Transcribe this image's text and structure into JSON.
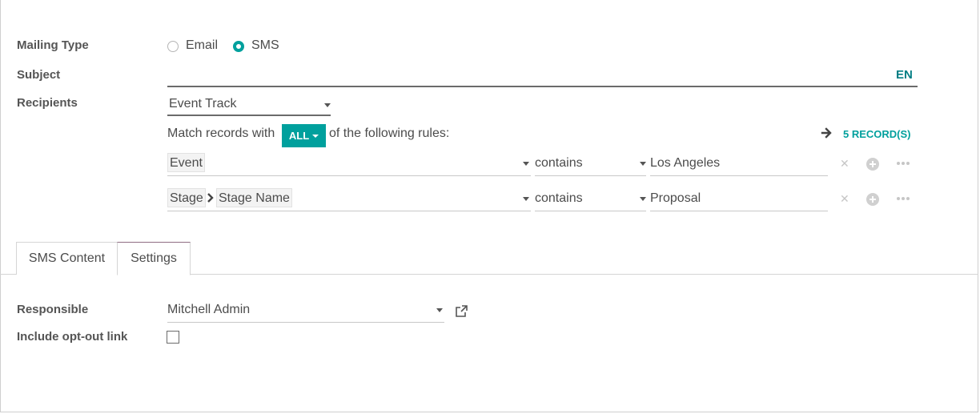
{
  "form": {
    "mailing_type_label": "Mailing Type",
    "mailing_type_options": [
      {
        "label": "Email",
        "checked": false
      },
      {
        "label": "SMS",
        "checked": true
      }
    ],
    "subject_label": "Subject",
    "subject_value": "",
    "language_code": "EN",
    "recipients_label": "Recipients",
    "recipients_value": "Event Track"
  },
  "domain": {
    "match_prefix": "Match records with",
    "match_mode": "ALL",
    "match_suffix": "of the following rules:",
    "records_link": "5 RECORD(S)",
    "rules": [
      {
        "path": [
          "Event"
        ],
        "operator": "contains",
        "value": "Los Angeles"
      },
      {
        "path": [
          "Stage",
          "Stage Name"
        ],
        "operator": "contains",
        "value": "Proposal"
      }
    ]
  },
  "tabs": [
    {
      "label": "SMS Content",
      "active": false
    },
    {
      "label": "Settings",
      "active": true
    }
  ],
  "settings": {
    "responsible_label": "Responsible",
    "responsible_value": "Mitchell Admin",
    "optout_label": "Include opt-out link",
    "optout_checked": false
  },
  "colors": {
    "accent": "#00a09d",
    "link": "#017e84",
    "tab_active_border": "#8f6d83"
  }
}
